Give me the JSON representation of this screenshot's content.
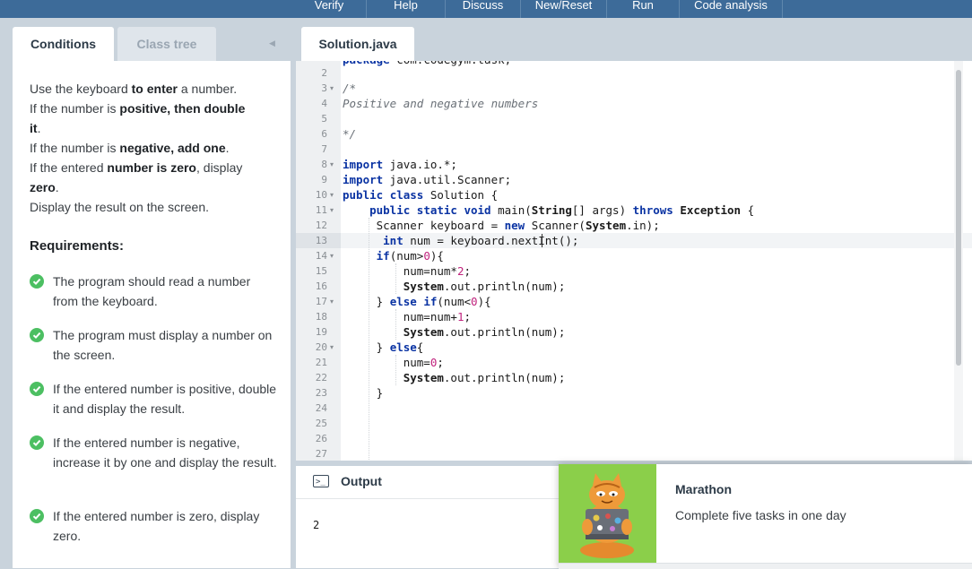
{
  "toolbar": {
    "verify": "Verify",
    "help": "Help",
    "discuss": "Discuss",
    "new_reset": "New/Reset",
    "run": "Run",
    "code_analysis": "Code analysis"
  },
  "left_tabs": {
    "conditions": "Conditions",
    "class_tree": "Class tree"
  },
  "conditions": {
    "lines": [
      [
        "Use the keyboard ",
        "to enter",
        " a number."
      ],
      [
        "If the number is ",
        "positive, then double",
        ""
      ],
      [
        "",
        "it",
        "."
      ],
      [
        "If the number is ",
        "negative, add one",
        "."
      ],
      [
        "If the entered ",
        "number is zero",
        ", display"
      ],
      [
        "",
        "zero",
        "."
      ],
      [
        "Display the result on the screen.",
        "",
        ""
      ]
    ],
    "requirements_title": "Requirements:",
    "requirements": [
      "The program should read a number from the keyboard.",
      "The program must display a number on the screen.",
      "If the entered number is positive, double it and display the result.",
      "If the entered number is negative, increase it by one and display the result.",
      "If the entered number is zero, display zero."
    ]
  },
  "editor": {
    "tab_label": "Solution.java",
    "line_numbers": [
      "2",
      "3",
      "4",
      "5",
      "6",
      "7",
      "8",
      "9",
      "10",
      "11",
      "12",
      "13",
      "14",
      "15",
      "16",
      "17",
      "18",
      "19",
      "20",
      "21",
      "22",
      "23",
      "24",
      "25",
      "26",
      "27"
    ],
    "fold_lines": [
      "3",
      "8",
      "10",
      "11",
      "14",
      "17",
      "20"
    ],
    "active_line": "13"
  },
  "output": {
    "title": "Output",
    "icon": "terminal-icon",
    "text": "2"
  },
  "popup": {
    "title": "Marathon",
    "description": "Complete five tasks in one day"
  },
  "colors": {
    "toolbar": "#3d6b99",
    "check": "#4cbf62",
    "popup_image_bg": "#8bcf4a",
    "keyword": "#0a33a3"
  }
}
